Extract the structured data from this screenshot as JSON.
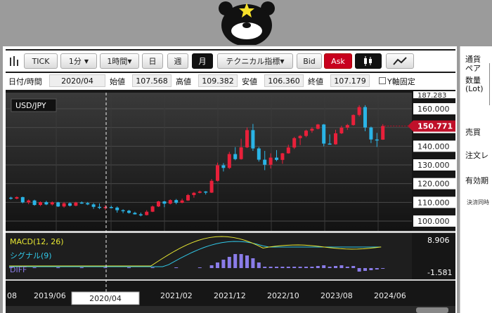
{
  "toolbar": {
    "tick_label": "TICK",
    "interval1": "1分",
    "interval2": "1時間",
    "day": "日",
    "week": "週",
    "month": "月",
    "technical": "テクニカル指標",
    "bid": "Bid",
    "ask": "Ask"
  },
  "info": {
    "date_label": "日付/時間",
    "date_value": "2020/04",
    "open_label": "始値",
    "open_value": "107.568",
    "high_label": "高値",
    "high_value": "109.382",
    "low_label": "安値",
    "low_value": "106.360",
    "close_label": "終値",
    "close_value": "107.179",
    "yfix_label": "Y軸固定"
  },
  "side": {
    "currency_line1": "通貨",
    "currency_line2": "ペア",
    "qty_line1": "数量",
    "qty_line2": "(Lot)",
    "buysell": "売買",
    "order": "注文レ",
    "expiry": "有効期",
    "settle": "決済同時"
  },
  "colors": {
    "up": "#e8203a",
    "down": "#2ab4e6",
    "macd": "#e8e832",
    "signal": "#30c8e8",
    "diff": "#8a7ce8",
    "price_tag": "#c0102a"
  },
  "chart_data": {
    "type": "candlestick",
    "symbol": "USD/JPY",
    "current_price": "150.771",
    "y_ticks": [
      "187.283",
      "160.000",
      "150.000",
      "140.000",
      "130.000",
      "120.000",
      "110.000",
      "100.000"
    ],
    "x_ticks": [
      "08",
      "2019/06",
      "2021/02",
      "2021/12",
      "2022/10",
      "2023/08",
      "2024/06"
    ],
    "crosshair_date": "2020/04",
    "ylim": [
      95,
      165
    ],
    "candles": [
      [
        112.5,
        113.0,
        111.5,
        112.0
      ],
      [
        112.0,
        113.2,
        111.6,
        112.8
      ],
      [
        112.8,
        113.0,
        109.5,
        110.0
      ],
      [
        110.0,
        111.5,
        109.0,
        111.0
      ],
      [
        111.0,
        111.4,
        108.2,
        108.6
      ],
      [
        108.6,
        110.5,
        108.0,
        110.1
      ],
      [
        110.1,
        110.8,
        108.5,
        108.9
      ],
      [
        108.9,
        110.5,
        108.3,
        110.0
      ],
      [
        110.0,
        110.3,
        107.5,
        107.8
      ],
      [
        107.8,
        110.2,
        107.2,
        109.5
      ],
      [
        109.5,
        110.0,
        107.8,
        108.2
      ],
      [
        108.2,
        110.3,
        107.9,
        109.9
      ],
      [
        109.9,
        110.5,
        109.2,
        109.6
      ],
      [
        109.6,
        110.2,
        108.5,
        108.9
      ],
      [
        108.9,
        109.6,
        106.5,
        107.6
      ],
      [
        107.6,
        109.4,
        106.4,
        107.2
      ],
      [
        107.2,
        108.5,
        106.0,
        107.5
      ],
      [
        107.5,
        108.2,
        106.8,
        107.2
      ],
      [
        107.2,
        107.8,
        104.5,
        105.8
      ],
      [
        105.8,
        106.3,
        104.2,
        105.5
      ],
      [
        105.5,
        106.0,
        104.0,
        104.4
      ],
      [
        104.4,
        105.0,
        103.5,
        103.6
      ],
      [
        103.6,
        104.5,
        102.5,
        103.2
      ],
      [
        103.2,
        105.8,
        103.0,
        105.0
      ],
      [
        105.0,
        108.3,
        104.8,
        107.8
      ],
      [
        107.8,
        110.8,
        107.5,
        110.5
      ],
      [
        110.5,
        110.8,
        107.4,
        109.3
      ],
      [
        109.3,
        111.6,
        108.9,
        111.2
      ],
      [
        111.2,
        111.8,
        109.0,
        109.8
      ],
      [
        109.8,
        112.0,
        109.5,
        111.0
      ],
      [
        111.0,
        114.5,
        110.8,
        113.9
      ],
      [
        113.9,
        115.5,
        112.5,
        115.1
      ],
      [
        115.1,
        116.3,
        114.8,
        115.8
      ],
      [
        115.8,
        116.0,
        114.2,
        115.2
      ],
      [
        115.2,
        122.5,
        115.0,
        121.5
      ],
      [
        121.5,
        131.2,
        121.2,
        129.8
      ],
      [
        129.8,
        131.0,
        126.5,
        128.4
      ],
      [
        128.4,
        137.0,
        127.8,
        135.8
      ],
      [
        135.8,
        139.5,
        132.5,
        133.1
      ],
      [
        133.1,
        144.0,
        132.8,
        139.4
      ],
      [
        139.4,
        150.0,
        139.0,
        148.6
      ],
      [
        148.6,
        151.9,
        137.5,
        138.8
      ],
      [
        138.8,
        139.6,
        131.8,
        132.8
      ],
      [
        132.8,
        137.5,
        127.2,
        130.1
      ],
      [
        130.1,
        136.2,
        128.1,
        133.9
      ],
      [
        133.9,
        137.9,
        132.0,
        132.7
      ],
      [
        132.7,
        136.4,
        130.6,
        136.2
      ],
      [
        136.2,
        140.8,
        136.0,
        139.3
      ],
      [
        139.3,
        145.0,
        138.5,
        144.3
      ],
      [
        144.3,
        146.0,
        140.6,
        145.5
      ],
      [
        145.5,
        148.8,
        144.8,
        148.3
      ],
      [
        148.3,
        150.2,
        147.2,
        149.3
      ],
      [
        149.3,
        151.9,
        149.0,
        151.6
      ],
      [
        151.6,
        151.9,
        139.9,
        141.4
      ],
      [
        141.4,
        146.3,
        140.9,
        141.0
      ],
      [
        141.0,
        148.8,
        140.8,
        146.9
      ],
      [
        146.9,
        150.9,
        146.5,
        149.9
      ],
      [
        149.9,
        151.9,
        148.7,
        151.3
      ],
      [
        151.3,
        157.0,
        151.0,
        156.7
      ],
      [
        156.7,
        161.9,
        155.9,
        160.9
      ],
      [
        160.9,
        161.9,
        148.0,
        150.0
      ],
      [
        150.0,
        150.5,
        141.7,
        143.6
      ],
      [
        143.6,
        147.1,
        139.6,
        143.5
      ],
      [
        143.5,
        151.8,
        143.4,
        150.8
      ]
    ],
    "indicator": {
      "macd_label": "MACD(12, 26)",
      "signal_label": "シグナル(9)",
      "diff_label": "DIFF",
      "upper_tick": "8.906",
      "lower_tick": "-1.581"
    }
  }
}
